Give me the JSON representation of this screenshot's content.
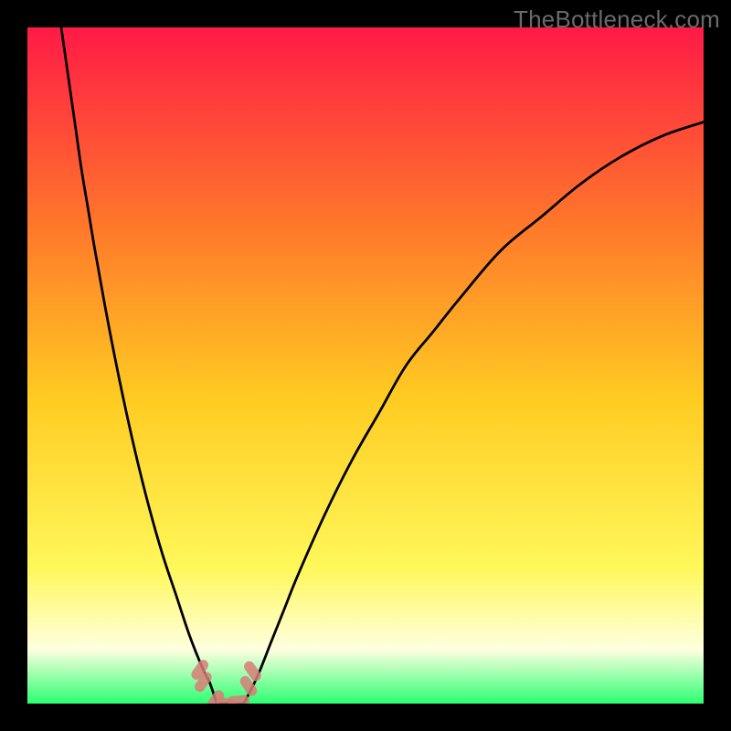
{
  "watermark": "TheBottleneck.com",
  "colors": {
    "gradient_top": "#ff1a46",
    "gradient_upper_mid": "#ff7a2a",
    "gradient_mid": "#ffcc22",
    "gradient_lower_mid": "#fff85a",
    "gradient_pale": "#ffffe0",
    "gradient_bottom": "#2cff72",
    "curve": "#000000",
    "marker": "#d87c79",
    "frame": "#000000"
  },
  "chart_data": {
    "type": "line",
    "title": "",
    "xlabel": "",
    "ylabel": "",
    "xlim": [
      0,
      100
    ],
    "ylim": [
      0,
      100
    ],
    "series": [
      {
        "name": "curve-left",
        "x": [
          5,
          6,
          7,
          8,
          9,
          10,
          12,
          14,
          16,
          18,
          20,
          22,
          24,
          26,
          27,
          28
        ],
        "y": [
          100,
          93,
          86,
          79,
          73,
          67,
          56,
          46,
          37,
          29,
          22,
          16,
          10,
          5,
          3,
          0
        ]
      },
      {
        "name": "curve-right",
        "x": [
          32,
          34,
          36,
          38,
          40,
          44,
          48,
          52,
          56,
          60,
          64,
          70,
          76,
          82,
          88,
          94,
          100
        ],
        "y": [
          0,
          4,
          9,
          14,
          19,
          28,
          36,
          43,
          50,
          55,
          60,
          67,
          72,
          77,
          81,
          84,
          86
        ]
      }
    ],
    "flat_segment": {
      "x_start": 28,
      "x_end": 32,
      "y": 0
    },
    "markers": [
      {
        "x": 25.5,
        "y": 5.0
      },
      {
        "x": 26.0,
        "y": 3.2
      },
      {
        "x": 27.8,
        "y": 0.5
      },
      {
        "x": 29.5,
        "y": 0.0
      },
      {
        "x": 31.2,
        "y": 0.4
      },
      {
        "x": 32.7,
        "y": 2.6
      },
      {
        "x": 33.3,
        "y": 4.8
      }
    ],
    "marker_shape": "capsule",
    "marker_size": 12
  }
}
